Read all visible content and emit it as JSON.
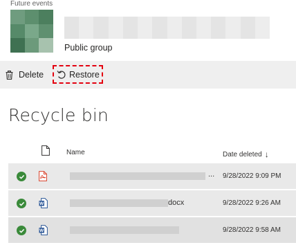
{
  "header": {
    "future_events_label": "Future events",
    "group_type": "Public group"
  },
  "command_bar": {
    "delete_label": "Delete",
    "restore_label": "Restore"
  },
  "page_title": "Recycle bin",
  "table": {
    "columns": {
      "name": "Name",
      "date_deleted": "Date deleted",
      "sort_indicator": "↓"
    },
    "rows": [
      {
        "file_type": "pdf-file-icon",
        "name_suffix": "...",
        "date": "9/28/2022 9:09 PM"
      },
      {
        "file_type": "word-file-icon",
        "name_suffix": "docx",
        "date": "9/28/2022 9:26 AM"
      },
      {
        "file_type": "word-file-icon",
        "name_suffix": "",
        "date": "9/28/2022 9:58 AM"
      }
    ]
  },
  "colors": {
    "highlight_outline": "#e3000f",
    "status_check": "#3a8a3a",
    "word_blue": "#2b5797",
    "pdf_red": "#d9412a"
  }
}
